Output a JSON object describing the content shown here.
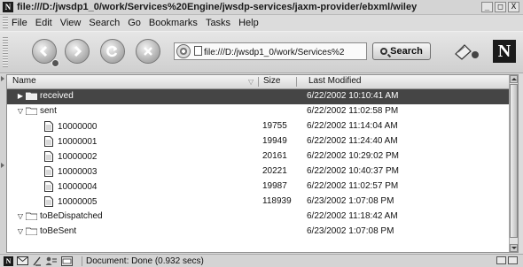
{
  "window": {
    "title": "file:///D:/jwsdp1_0/work/Services%20Engine/jwsdp-services/jaxm-provider/ebxml/wiley",
    "buttons": {
      "minimize": "_",
      "maximize": "□",
      "close": "X"
    }
  },
  "menubar": {
    "items": [
      "File",
      "Edit",
      "View",
      "Search",
      "Go",
      "Bookmarks",
      "Tasks",
      "Help"
    ]
  },
  "toolbar": {
    "url": "file:///D:/jwsdp1_0/work/Services%2",
    "search_label": "Search",
    "icons": [
      "back-icon",
      "forward-icon",
      "reload-icon",
      "stop-icon",
      "go-icon",
      "print-icon",
      "netscape-logo"
    ],
    "logo_letter": "N"
  },
  "columns": {
    "name": "Name",
    "size": "Size",
    "modified": "Last Modified"
  },
  "rows": [
    {
      "name": "received",
      "type": "folder",
      "expanded": false,
      "depth": 0,
      "size": "",
      "modified": "6/22/2002 10:10:41 AM",
      "selected": true
    },
    {
      "name": "sent",
      "type": "folder",
      "expanded": true,
      "depth": 0,
      "size": "",
      "modified": "6/22/2002 11:02:58 PM",
      "selected": false
    },
    {
      "name": "10000000",
      "type": "file",
      "depth": 1,
      "size": "19755",
      "modified": "6/22/2002 11:14:04 AM",
      "selected": false
    },
    {
      "name": "10000001",
      "type": "file",
      "depth": 1,
      "size": "19949",
      "modified": "6/22/2002 11:24:40 AM",
      "selected": false
    },
    {
      "name": "10000002",
      "type": "file",
      "depth": 1,
      "size": "20161",
      "modified": "6/22/2002 10:29:02 PM",
      "selected": false
    },
    {
      "name": "10000003",
      "type": "file",
      "depth": 1,
      "size": "20221",
      "modified": "6/22/2002 10:40:37 PM",
      "selected": false
    },
    {
      "name": "10000004",
      "type": "file",
      "depth": 1,
      "size": "19987",
      "modified": "6/22/2002 11:02:57 PM",
      "selected": false
    },
    {
      "name": "10000005",
      "type": "file",
      "depth": 1,
      "size": "118939",
      "modified": "6/23/2002 1:07:08 PM",
      "selected": false
    },
    {
      "name": "toBeDispatched",
      "type": "folder",
      "expanded": true,
      "depth": 0,
      "size": "",
      "modified": "6/22/2002 11:18:42 AM",
      "selected": false
    },
    {
      "name": "toBeSent",
      "type": "folder",
      "expanded": true,
      "depth": 0,
      "size": "",
      "modified": "6/23/2002 1:07:08 PM",
      "selected": false
    }
  ],
  "statusbar": {
    "text": "Document: Done (0.932 secs)",
    "icons": [
      "netscape-icon",
      "mail-icon",
      "composer-icon",
      "address-book-icon",
      "chat-icon"
    ]
  }
}
